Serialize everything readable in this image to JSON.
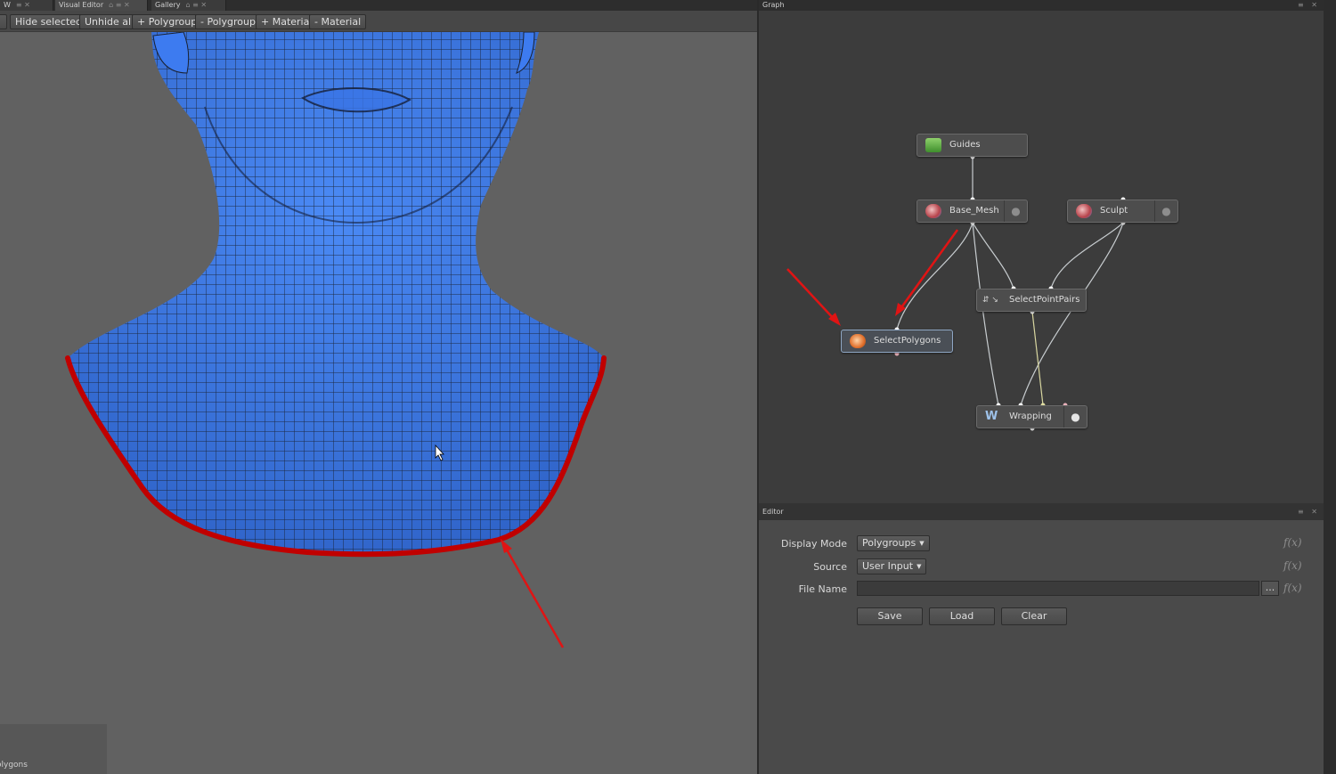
{
  "left_tabs": [
    {
      "label": "W"
    },
    {
      "label": "Visual Editor"
    },
    {
      "label": "Gallery"
    }
  ],
  "toolbar": {
    "buttons": [
      "Hide selected",
      "Unhide all",
      "+ Polygroup",
      "- Polygroup",
      "+ Material",
      "- Material"
    ]
  },
  "viewport": {
    "mesh_color": "#3d7bf0",
    "wire_color": "#1a2233",
    "highlight_color": "#c00000",
    "annotation_color": "#e01414",
    "corner_label": "olygons"
  },
  "graph": {
    "title": "Graph",
    "nodes": {
      "guides": {
        "label": "Guides",
        "icon": "image-icon"
      },
      "base_mesh": {
        "label": "Base_Mesh",
        "icon": "head-icon"
      },
      "sculpt": {
        "label": "Sculpt",
        "icon": "head-icon"
      },
      "select_point_pairs": {
        "label": "SelectPointPairs",
        "icon": "point-pairs-icon"
      },
      "select_polygons": {
        "label": "SelectPolygons",
        "icon": "select-polygons-icon"
      },
      "wrapping": {
        "label": "Wrapping",
        "icon": "wrap-w-icon"
      }
    },
    "connection_color": "#c8cdd0",
    "arrow_color": "#e01414"
  },
  "editor": {
    "title": "Editor",
    "display_mode": {
      "label": "Display Mode",
      "value": "Polygroups"
    },
    "source": {
      "label": "Source",
      "value": "User Input"
    },
    "file_name": {
      "label": "File Name",
      "value": "",
      "browse": "..."
    },
    "fx_symbol": "f(x)",
    "buttons": {
      "save": "Save",
      "load": "Load",
      "clear": "Clear"
    }
  }
}
